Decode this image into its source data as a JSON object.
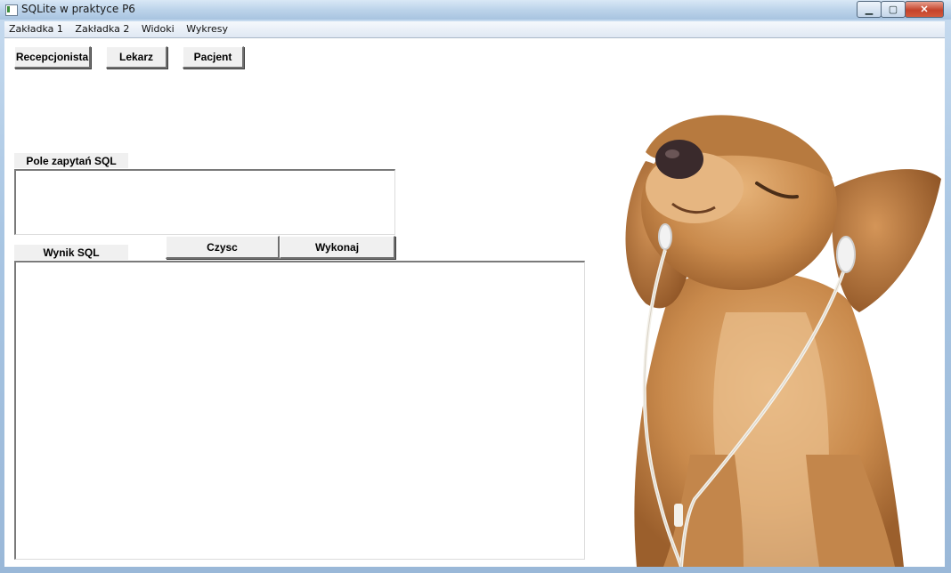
{
  "window": {
    "title": "SQLite w praktyce P6"
  },
  "menu": [
    "Zakładka 1",
    "Zakładka 2",
    "Widoki",
    "Wykresy"
  ],
  "roles": {
    "recepcjonista": "Recepcjonista",
    "lekarz": "Lekarz",
    "pacjent": "Pacjent"
  },
  "query": {
    "label": "Pole zapytań SQL",
    "value": ""
  },
  "actions": {
    "clear": "Czysc",
    "execute": "Wykonaj"
  },
  "result": {
    "label": "Wynik SQL",
    "value": ""
  },
  "colors": {
    "frame": "#a9c6e3",
    "button_face": "#f0f0f0",
    "close": "#c4432b"
  },
  "illustration": {
    "name": "puppy-with-earphones"
  }
}
